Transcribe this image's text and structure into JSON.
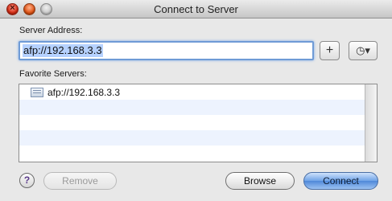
{
  "window": {
    "title": "Connect to Server"
  },
  "address": {
    "label": "Server Address:",
    "value": "afp://192.168.3.3"
  },
  "buttons": {
    "add": "+",
    "recent": "⌚▾"
  },
  "favorites": {
    "label": "Favorite Servers:",
    "items": [
      {
        "text": "afp://192.168.3.3",
        "icon": "server-icon"
      }
    ]
  },
  "footer": {
    "help": "?",
    "remove": "Remove",
    "browse": "Browse",
    "connect": "Connect"
  },
  "colors": {
    "accent": "#6f9bd6",
    "connect": "#4f88d9",
    "stripe": "#edf3fe"
  }
}
